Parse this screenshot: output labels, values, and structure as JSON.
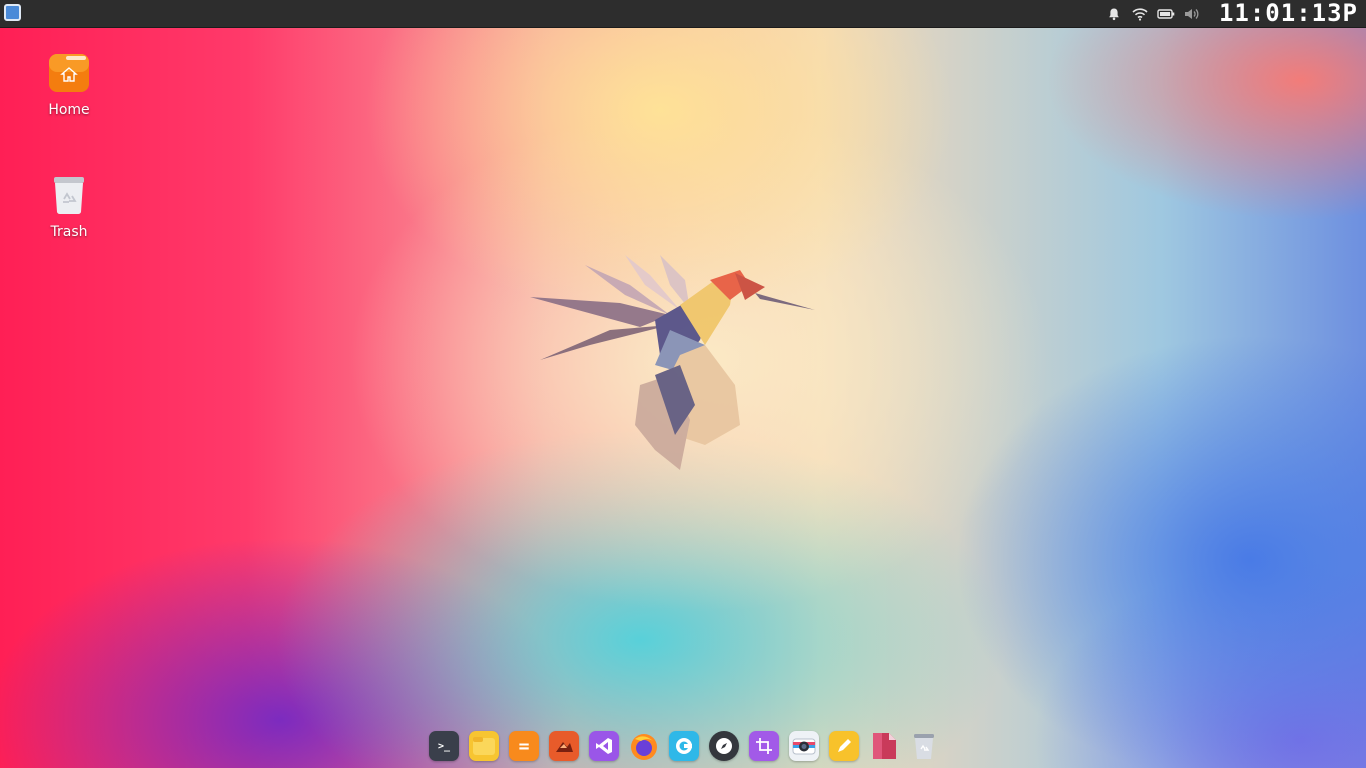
{
  "topbar": {
    "clock": "11:01:13P"
  },
  "desktop": {
    "icons": [
      {
        "label": "Home",
        "icon": "home-folder-icon"
      },
      {
        "label": "Trash",
        "icon": "trash-icon"
      }
    ]
  },
  "tray": {
    "icons": [
      "bell-icon",
      "wifi-icon",
      "battery-icon",
      "volume-icon"
    ]
  },
  "dock": {
    "items": [
      {
        "icon": "terminal-icon",
        "glyph": ">_",
        "color": "#3a3f4b"
      },
      {
        "icon": "files-icon",
        "glyph": "",
        "color": "#f7c531"
      },
      {
        "icon": "calculator-icon",
        "glyph": "=",
        "color": "#f88a1c"
      },
      {
        "icon": "image-editor-icon",
        "glyph": "",
        "color": "#e85b2a"
      },
      {
        "icon": "vscode-icon",
        "glyph": "⋊",
        "color": "#9a56e8"
      },
      {
        "icon": "firefox-icon",
        "glyph": "",
        "color": "#ff7a1a"
      },
      {
        "icon": "browser-icon",
        "glyph": "C",
        "color": "#2fb8e8"
      },
      {
        "icon": "compass-icon",
        "glyph": "",
        "color": "#34373d"
      },
      {
        "icon": "screenshot-crop-icon",
        "glyph": "",
        "color": "#a25ae8"
      },
      {
        "icon": "camera-icon",
        "glyph": "",
        "color": "#eef2f6"
      },
      {
        "icon": "notes-icon",
        "glyph": "",
        "color": "#f8c22b"
      },
      {
        "icon": "document-viewer-icon",
        "glyph": "",
        "color": "#c93a5a"
      },
      {
        "icon": "trash-icon",
        "glyph": "",
        "color": "#c9ced6"
      }
    ]
  }
}
